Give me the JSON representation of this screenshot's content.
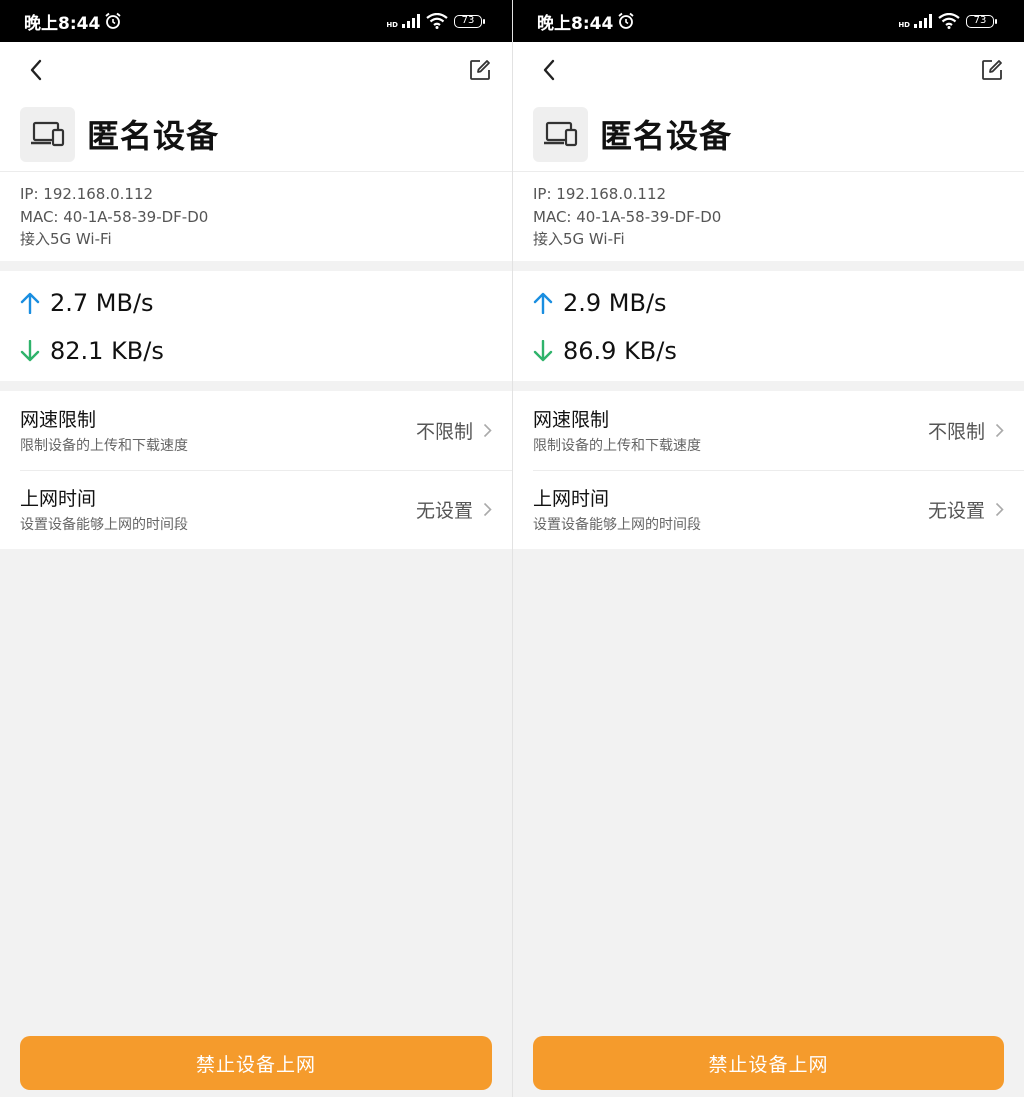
{
  "colors": {
    "accent": "#f59b2c",
    "upload_arrow": "#1a8ee0",
    "download_arrow": "#2fb36b"
  },
  "panels": [
    {
      "status": {
        "time": "晚上8:44",
        "signal_label": "HD",
        "battery": "73"
      },
      "device": {
        "name": "匿名设备",
        "ip": "IP: 192.168.0.112",
        "mac": "MAC: 40-1A-58-39-DF-D0",
        "connection": "接入5G Wi-Fi"
      },
      "speed": {
        "upload": "2.7 MB/s",
        "download": "82.1 KB/s"
      },
      "settings": [
        {
          "title": "网速限制",
          "desc": "限制设备的上传和下载速度",
          "value": "不限制"
        },
        {
          "title": "上网时间",
          "desc": "设置设备能够上网的时间段",
          "value": "无设置"
        }
      ],
      "action": "禁止设备上网"
    },
    {
      "status": {
        "time": "晚上8:44",
        "signal_label": "HD",
        "battery": "73"
      },
      "device": {
        "name": "匿名设备",
        "ip": "IP: 192.168.0.112",
        "mac": "MAC: 40-1A-58-39-DF-D0",
        "connection": "接入5G Wi-Fi"
      },
      "speed": {
        "upload": "2.9 MB/s",
        "download": "86.9 KB/s"
      },
      "settings": [
        {
          "title": "网速限制",
          "desc": "限制设备的上传和下载速度",
          "value": "不限制"
        },
        {
          "title": "上网时间",
          "desc": "设置设备能够上网的时间段",
          "value": "无设置"
        }
      ],
      "action": "禁止设备上网"
    }
  ]
}
